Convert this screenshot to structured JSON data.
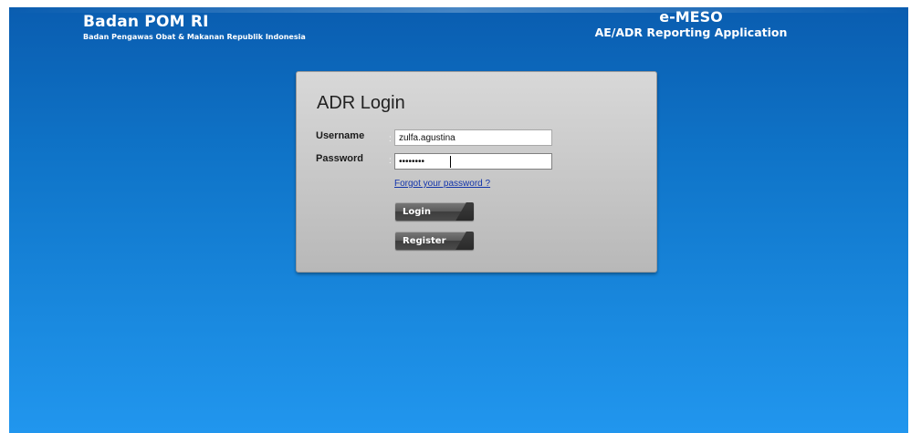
{
  "header": {
    "org_title": "Badan POM RI",
    "org_subtitle": "Badan Pengawas Obat & Makanan Republik Indonesia",
    "app_name": "e-MESO",
    "app_description": "AE/ADR Reporting Application"
  },
  "login": {
    "title": "ADR Login",
    "username_label": "Username",
    "password_label": "Password",
    "separator": ":",
    "username_value": "zulfa.agustina",
    "password_value": "••••••••",
    "forgot_link": "Forgot your password ?",
    "login_button": "Login",
    "register_button": "Register"
  },
  "colors": {
    "background_top": "#0a5db0",
    "background_bottom": "#2196ee",
    "panel": "#c8c8c8",
    "button": "#4a4a4a",
    "link": "#1133aa"
  }
}
